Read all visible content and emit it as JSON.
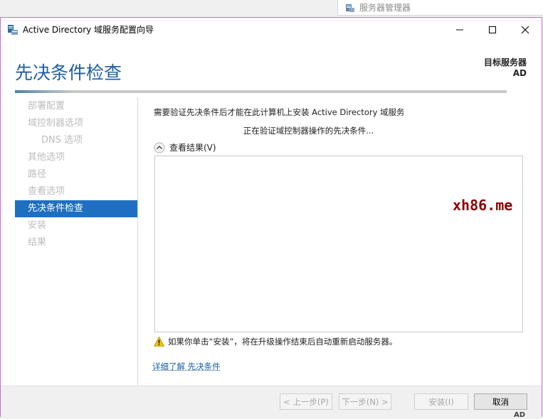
{
  "background_window": {
    "title": "服务器管理器",
    "corner_text": "AD"
  },
  "dialog": {
    "title": "Active Directory 域服务配置向导",
    "page_title": "先决条件检查",
    "target_server_label": "目标服务器",
    "target_server_name": "AD"
  },
  "nav": {
    "items": [
      {
        "label": "部署配置",
        "state": "disabled"
      },
      {
        "label": "域控制器选项",
        "state": "disabled"
      },
      {
        "label": "DNS 选项",
        "state": "disabled"
      },
      {
        "label": "其他选项",
        "state": "disabled"
      },
      {
        "label": "路径",
        "state": "disabled"
      },
      {
        "label": "查看选项",
        "state": "disabled"
      },
      {
        "label": "先决条件检查",
        "state": "active"
      },
      {
        "label": "安装",
        "state": "disabled"
      },
      {
        "label": "结果",
        "state": "disabled"
      }
    ]
  },
  "content": {
    "description": "需要验证先决条件后才能在此计算机上安装 Active Directory 域服务",
    "status": "正在验证域控制器操作的先决条件...",
    "results_toggle_label": "查看结果(V)",
    "warning_text": "如果你单击“安装”，将在升级操作结束后自动重新启动服务器。",
    "more_link": "详细了解 先决条件"
  },
  "watermark": "xh86.me",
  "buttons": {
    "prev": "< 上一步(P)",
    "next": "下一步(N) >",
    "install": "安装(I)",
    "cancel": "取消"
  },
  "colors": {
    "accent": "#1e6fc1",
    "title_blue": "#1e5fa2",
    "window_border": "#c86bd5",
    "watermark": "#8b0000"
  }
}
